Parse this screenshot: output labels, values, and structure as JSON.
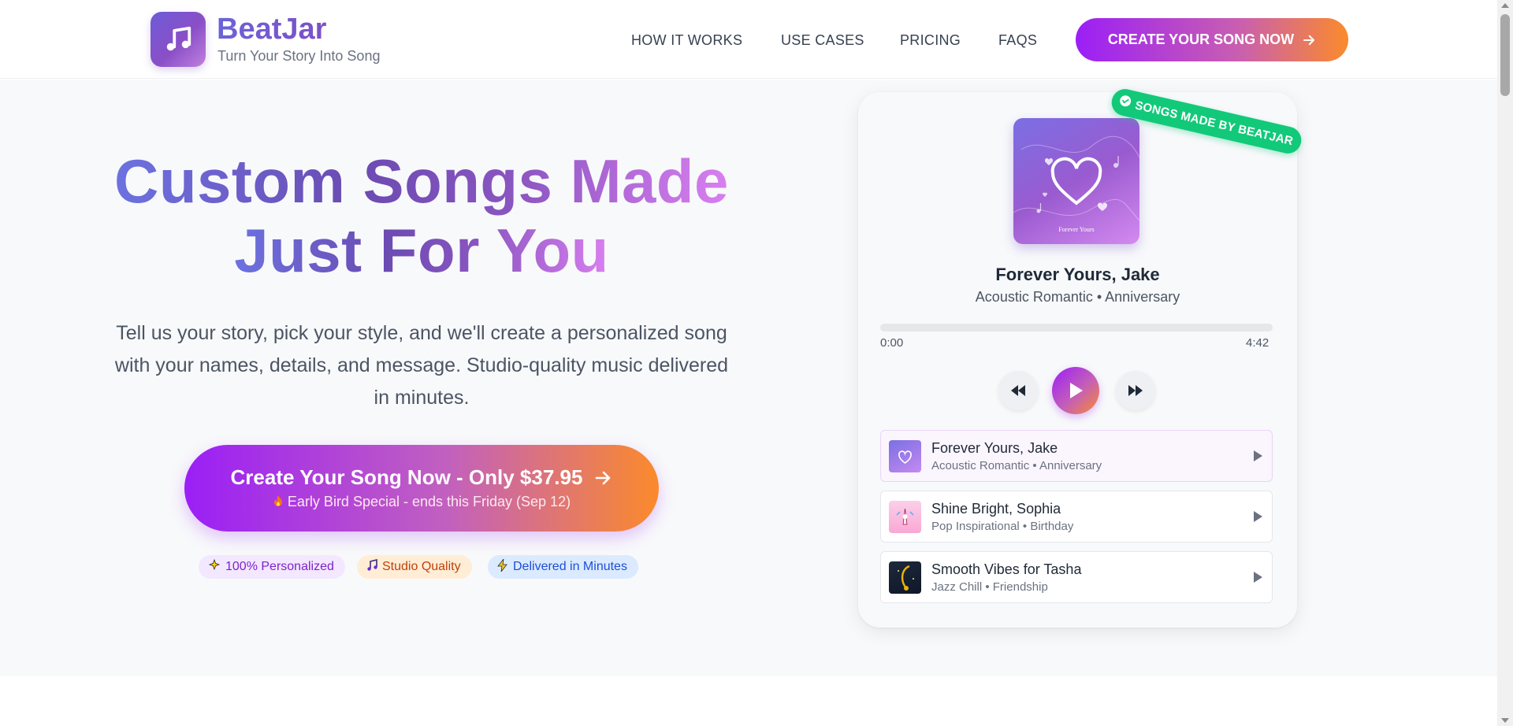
{
  "header": {
    "brand_name": "BeatJar",
    "brand_tagline": "Turn Your Story Into Song",
    "nav": [
      "HOW IT WORKS",
      "USE CASES",
      "PRICING",
      "FAQS"
    ],
    "cta_label": "CREATE YOUR SONG NOW"
  },
  "hero": {
    "headline_line1": "Custom Songs Made",
    "headline_line2": "Just For You",
    "subtext": "Tell us your story, pick your style, and we'll create a personalized song with your names, details, and message. Studio-quality music delivered in minutes.",
    "cta_line1": "Create Your Song Now - Only $37.95",
    "cta_line2": "Early Bird Special - ends this Friday (Sep 12)",
    "badges": [
      {
        "label": "100% Personalized",
        "icon": "sparkle-icon"
      },
      {
        "label": "Studio Quality",
        "icon": "music-note-icon"
      },
      {
        "label": "Delivered in Minutes",
        "icon": "lightning-icon"
      }
    ]
  },
  "player": {
    "ribbon": "SONGS MADE BY BEATJAR",
    "cover_caption": "Forever Yours",
    "now_playing_title": "Forever Yours, Jake",
    "now_playing_sub": "Acoustic Romantic • Anniversary",
    "current_time": "0:00",
    "duration": "4:42",
    "progress": 0,
    "tracks": [
      {
        "title": "Forever Yours, Jake",
        "sub": "Acoustic Romantic • Anniversary",
        "active": true
      },
      {
        "title": "Shine Bright, Sophia",
        "sub": "Pop Inspirational • Birthday",
        "active": false
      },
      {
        "title": "Smooth Vibes for Tasha",
        "sub": "Jazz Chill • Friendship",
        "active": false
      }
    ]
  },
  "colors": {
    "accent_purple": "#9b1ff6",
    "accent_orange": "#fb8a2b",
    "ribbon_green": "#12c97a"
  }
}
